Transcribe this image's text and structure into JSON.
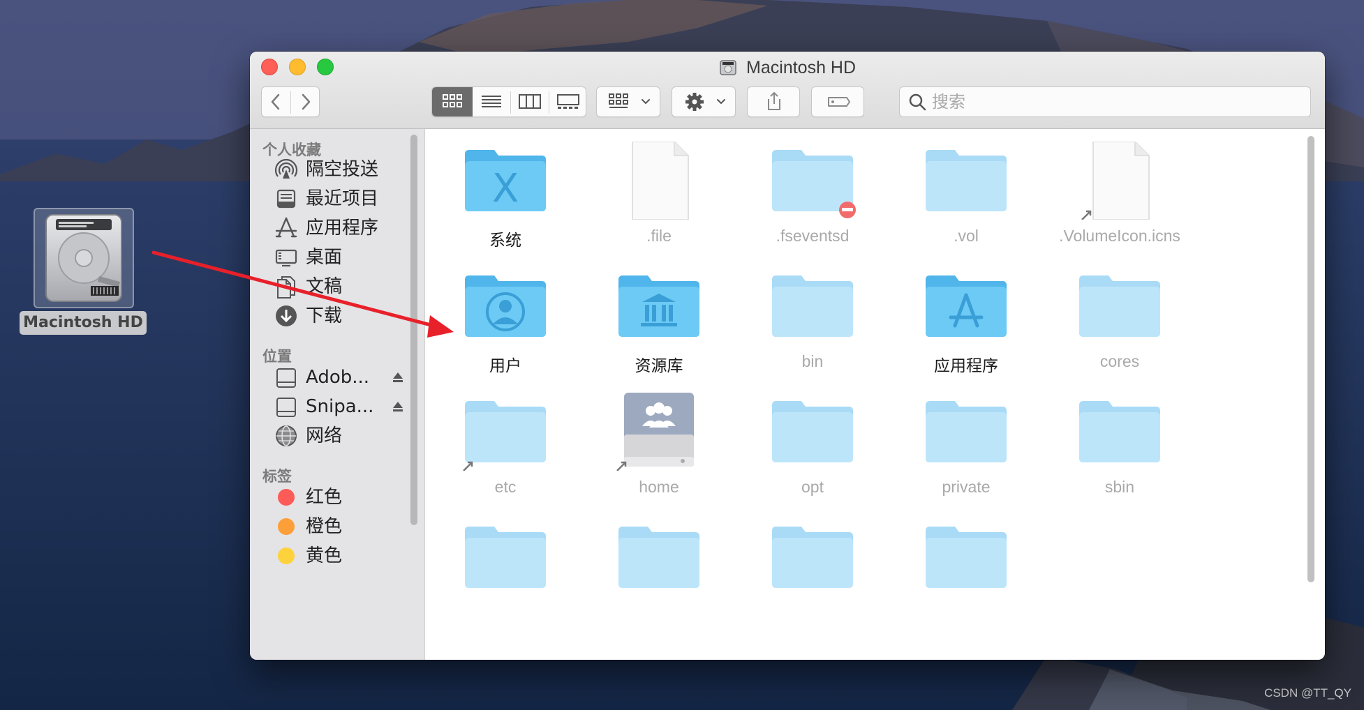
{
  "window": {
    "title": "Macintosh HD"
  },
  "toolbar": {
    "back": "back",
    "forward": "forward",
    "view_modes": [
      "icon",
      "list",
      "column",
      "gallery"
    ],
    "active_view": "icon",
    "search_placeholder": "搜索"
  },
  "sidebar": {
    "favorites_title": "个人收藏",
    "favorites": [
      {
        "label": "隔空投送",
        "icon": "airdrop-icon"
      },
      {
        "label": "最近项目",
        "icon": "recents-icon"
      },
      {
        "label": "应用程序",
        "icon": "applications-icon"
      },
      {
        "label": "桌面",
        "icon": "desktop-icon"
      },
      {
        "label": "文稿",
        "icon": "documents-icon"
      },
      {
        "label": "下载",
        "icon": "downloads-icon"
      }
    ],
    "locations_title": "位置",
    "locations": [
      {
        "label": "Adob...",
        "icon": "disk-icon",
        "ejectable": true
      },
      {
        "label": "Snipa...",
        "icon": "disk-icon",
        "ejectable": true
      },
      {
        "label": "网络",
        "icon": "network-icon",
        "ejectable": false
      }
    ],
    "tags_title": "标签",
    "tags": [
      {
        "label": "红色",
        "color": "#fc5b57"
      },
      {
        "label": "橙色",
        "color": "#fd9f38"
      },
      {
        "label": "黄色",
        "color": "#fdd23c"
      }
    ]
  },
  "files": [
    {
      "name": "系统",
      "kind": "system-folder",
      "dim": false
    },
    {
      "name": ".file",
      "kind": "document",
      "dim": true
    },
    {
      "name": ".fseventsd",
      "kind": "folder-restricted",
      "dim": true
    },
    {
      "name": ".vol",
      "kind": "folder",
      "dim": true
    },
    {
      "name": ".VolumeIcon.icns",
      "kind": "document-alias",
      "dim": true
    },
    {
      "name": "用户",
      "kind": "users-folder",
      "dim": false
    },
    {
      "name": "资源库",
      "kind": "library-folder",
      "dim": false
    },
    {
      "name": "bin",
      "kind": "folder",
      "dim": true
    },
    {
      "name": "应用程序",
      "kind": "applications-folder",
      "dim": false
    },
    {
      "name": "cores",
      "kind": "folder",
      "dim": true
    },
    {
      "name": "etc",
      "kind": "folder-alias",
      "dim": true
    },
    {
      "name": "home",
      "kind": "network-drive-alias",
      "dim": true
    },
    {
      "name": "opt",
      "kind": "folder",
      "dim": true
    },
    {
      "name": "private",
      "kind": "folder",
      "dim": true
    },
    {
      "name": "sbin",
      "kind": "folder",
      "dim": true
    },
    {
      "name": "",
      "kind": "folder",
      "dim": true
    },
    {
      "name": "",
      "kind": "folder",
      "dim": true
    },
    {
      "name": "",
      "kind": "folder",
      "dim": true
    },
    {
      "name": "",
      "kind": "folder",
      "dim": true
    }
  ],
  "desktop": {
    "drive_label": "Macintosh HD",
    "watermark": "CSDN @TT_QY"
  },
  "colors": {
    "arrow": "#e8202a",
    "folder": "#5ec1f2",
    "folder_dim": "#b8e2f8"
  }
}
